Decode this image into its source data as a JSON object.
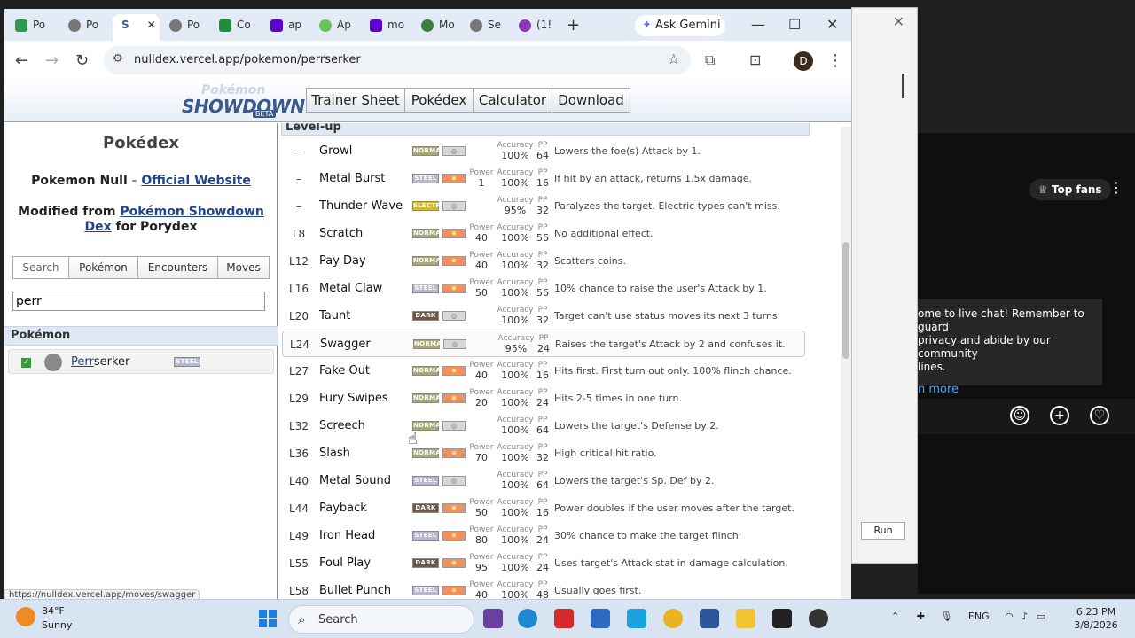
{
  "browser": {
    "tabs": [
      "Po",
      "Po",
      "S",
      "Po",
      "Co",
      "ap",
      "Ap",
      "mo",
      "Mo",
      "Se",
      "(1!"
    ],
    "ask_gemini": "Ask Gemini",
    "url": "nulldex.vercel.app/pokemon/perrserker",
    "profile_initial": "D",
    "status_url": "https://nulldex.vercel.app/moves/swagger"
  },
  "site": {
    "logo_line1": "Pokémon",
    "logo_line2": "SHOWDOWN!",
    "logo_badge": "BETA",
    "nav": [
      "Trainer Sheet",
      "Pokédex",
      "Calculator",
      "Download"
    ]
  },
  "left": {
    "title": "Pokédex",
    "null_prefix": "Pokemon Null",
    "null_sep": " - ",
    "null_link": "Official Website",
    "mod_prefix": "Modified from ",
    "mod_link": "Pokémon Showdown Dex",
    "mod_suffix": " for Porydex",
    "search_tabs": [
      "Search",
      "Pokémon",
      "Encounters",
      "Moves"
    ],
    "search_value": "perr",
    "results_header": "Pokémon",
    "result_match": "Perr",
    "result_rest": "serker",
    "result_type": "STEEL"
  },
  "right": {
    "section": "Level-up",
    "moves": [
      {
        "lv": "–",
        "name": "Growl",
        "type": "NORMAL",
        "tcls": "t-normal",
        "cat": "status",
        "power": "",
        "acc": "100%",
        "pp": "64",
        "desc": "Lowers the foe(s) Attack by 1."
      },
      {
        "lv": "–",
        "name": "Metal Burst",
        "type": "STEEL",
        "tcls": "t-steel",
        "cat": "physical",
        "power": "1",
        "acc": "100%",
        "pp": "16",
        "desc": "If hit by an attack, returns 1.5x damage."
      },
      {
        "lv": "–",
        "name": "Thunder Wave",
        "type": "ELECTR",
        "tcls": "t-electric",
        "cat": "status",
        "power": "",
        "acc": "95%",
        "pp": "32",
        "desc": "Paralyzes the target. Electric types can't miss."
      },
      {
        "lv": "L8",
        "name": "Scratch",
        "type": "NORMAL",
        "tcls": "t-normal",
        "cat": "physical",
        "power": "40",
        "acc": "100%",
        "pp": "56",
        "desc": "No additional effect."
      },
      {
        "lv": "L12",
        "name": "Pay Day",
        "type": "NORMAL",
        "tcls": "t-normal",
        "cat": "physical",
        "power": "40",
        "acc": "100%",
        "pp": "32",
        "desc": "Scatters coins."
      },
      {
        "lv": "L16",
        "name": "Metal Claw",
        "type": "STEEL",
        "tcls": "t-steel",
        "cat": "physical",
        "power": "50",
        "acc": "100%",
        "pp": "56",
        "desc": "10% chance to raise the user's Attack by 1."
      },
      {
        "lv": "L20",
        "name": "Taunt",
        "type": "DARK",
        "tcls": "t-dark",
        "cat": "status",
        "power": "",
        "acc": "100%",
        "pp": "32",
        "desc": "Target can't use status moves its next 3 turns."
      },
      {
        "lv": "L24",
        "name": "Swagger",
        "type": "NORMAL",
        "tcls": "t-normal",
        "cat": "status",
        "power": "",
        "acc": "95%",
        "pp": "24",
        "desc": "Raises the target's Attack by 2 and confuses it."
      },
      {
        "lv": "L27",
        "name": "Fake Out",
        "type": "NORMAL",
        "tcls": "t-normal",
        "cat": "physical",
        "power": "40",
        "acc": "100%",
        "pp": "16",
        "desc": "Hits first. First turn out only. 100% flinch chance."
      },
      {
        "lv": "L29",
        "name": "Fury Swipes",
        "type": "NORMAL",
        "tcls": "t-normal",
        "cat": "physical",
        "power": "20",
        "acc": "100%",
        "pp": "24",
        "desc": "Hits 2-5 times in one turn."
      },
      {
        "lv": "L32",
        "name": "Screech",
        "type": "NORMAL",
        "tcls": "t-normal",
        "cat": "status",
        "power": "",
        "acc": "100%",
        "pp": "64",
        "desc": "Lowers the target's Defense by 2."
      },
      {
        "lv": "L36",
        "name": "Slash",
        "type": "NORMAL",
        "tcls": "t-normal",
        "cat": "physical",
        "power": "70",
        "acc": "100%",
        "pp": "32",
        "desc": "High critical hit ratio."
      },
      {
        "lv": "L40",
        "name": "Metal Sound",
        "type": "STEEL",
        "tcls": "t-steel",
        "cat": "status",
        "power": "",
        "acc": "100%",
        "pp": "64",
        "desc": "Lowers the target's Sp. Def by 2."
      },
      {
        "lv": "L44",
        "name": "Payback",
        "type": "DARK",
        "tcls": "t-dark",
        "cat": "physical",
        "power": "50",
        "acc": "100%",
        "pp": "16",
        "desc": "Power doubles if the user moves after the target."
      },
      {
        "lv": "L49",
        "name": "Iron Head",
        "type": "STEEL",
        "tcls": "t-steel",
        "cat": "physical",
        "power": "80",
        "acc": "100%",
        "pp": "24",
        "desc": "30% chance to make the target flinch."
      },
      {
        "lv": "L55",
        "name": "Foul Play",
        "type": "DARK",
        "tcls": "t-dark",
        "cat": "physical",
        "power": "95",
        "acc": "100%",
        "pp": "24",
        "desc": "Uses target's Attack stat in damage calculation."
      },
      {
        "lv": "L58",
        "name": "Bullet Punch",
        "type": "STEEL",
        "tcls": "t-steel",
        "cat": "physical",
        "power": "40",
        "acc": "100%",
        "pp": "48",
        "desc": "Usually goes first."
      }
    ],
    "labels": {
      "power": "Power",
      "accuracy": "Accuracy",
      "pp": "PP"
    }
  },
  "chat": {
    "top_fans": "Top fans",
    "message_lines": [
      "ome to live chat! Remember to guard",
      "privacy and abide by our community",
      "lines."
    ],
    "learn_more": "n more",
    "run": "Run"
  },
  "taskbar": {
    "temp": "84°F",
    "condition": "Sunny",
    "search": "Search",
    "lang": "ENG",
    "time": "6:23 PM",
    "date": "3/8/2026"
  }
}
